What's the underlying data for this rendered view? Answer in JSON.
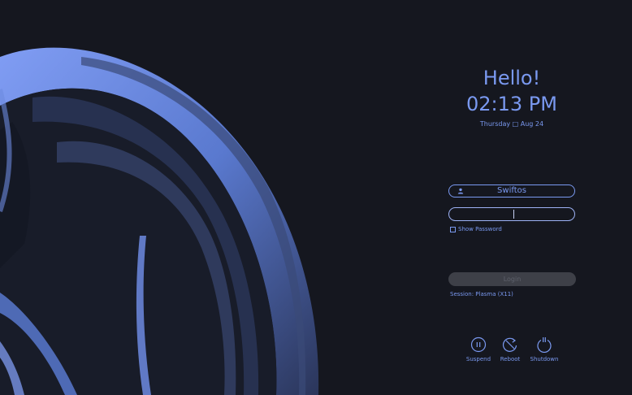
{
  "greeter": {
    "greeting": "Hello!",
    "time": "02:13 PM",
    "date": "Thursday □ Aug 24"
  },
  "user": {
    "username": "Swiftos",
    "icon": "user-icon"
  },
  "password": {
    "value": "",
    "show_password_label": "Show Password",
    "show_password_checked": false
  },
  "login": {
    "label": "Login",
    "enabled": false
  },
  "session": {
    "label": "Session: Plasma (X11)"
  },
  "power": {
    "suspend_label": "Suspend",
    "reboot_label": "Reboot",
    "shutdown_label": "Shutdown"
  },
  "colors": {
    "background": "#15171f",
    "accent": "#7a99f0",
    "wallpaper_highlight": "#7b9cf6",
    "wallpaper_shadow": "#2a3350",
    "login_disabled": "#3e4048"
  }
}
